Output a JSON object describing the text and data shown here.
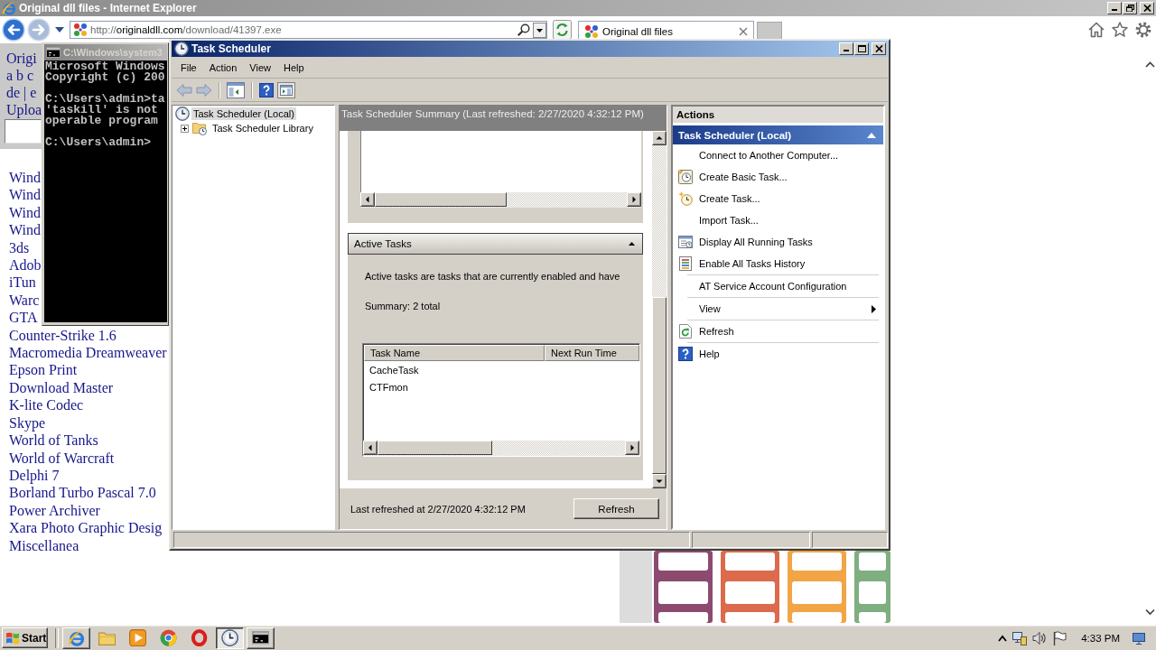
{
  "browser": {
    "title": "Original dll files - Internet Explorer",
    "address": {
      "scheme": "http://",
      "domain": "originaldll.com",
      "path": "/download/41397.exe"
    },
    "tabs": [
      {
        "label": "Original dll files",
        "selected": true
      }
    ]
  },
  "web_page": {
    "header_lines": [
      "Origi",
      "a b c",
      "de | e",
      "Uploa"
    ],
    "links": [
      "Wind",
      "Wind",
      "Wind",
      "Wind",
      "3ds",
      "Adob",
      "iTun",
      "Warc",
      "GTA",
      "Counter-Strike 1.6",
      "Macromedia Dreamweaver",
      "Epson Print",
      "Download Master",
      "K-lite Codec",
      "Skype",
      "World of Tanks",
      "World of Warcraft",
      "Delphi 7",
      "Borland Turbo Pascal 7.0",
      "Power Archiver",
      "Xara Photo Graphic Desig",
      "Miscellanea"
    ]
  },
  "console": {
    "title": "C:\\Windows\\system3",
    "paragraphs": [
      [
        "Microsoft Windows",
        "Copyright (c) 200"
      ],
      [
        "C:\\Users\\admin>ta",
        "'taskill' is not",
        "operable program"
      ],
      [
        "C:\\Users\\admin>"
      ]
    ]
  },
  "task_scheduler": {
    "title": "Task Scheduler",
    "menu": [
      "File",
      "Action",
      "View",
      "Help"
    ],
    "tree": [
      {
        "label": "Task Scheduler (Local)",
        "selected": true,
        "children": [
          {
            "label": "Task Scheduler Library",
            "selected": false,
            "expanded": false
          }
        ]
      }
    ],
    "summary_title": "Task Scheduler Summary (Last refreshed: 2/27/2020 4:32:12 PM)",
    "active_tasks": {
      "title": "Active Tasks",
      "expanded": true,
      "description": "Active tasks are tasks that are currently enabled and have",
      "summary": "Summary: 2 total",
      "columns": [
        "Task Name",
        "Next Run Time"
      ],
      "rows": [
        {
          "task_name": "CacheTask"
        },
        {
          "task_name": "CTFmon"
        }
      ]
    },
    "footer": {
      "status": "Last refreshed at 2/27/2020 4:32:12 PM",
      "button": "Refresh"
    },
    "actions": {
      "title": "Actions",
      "section": {
        "title": "Task Scheduler (Local)",
        "expanded": true
      },
      "groups": [
        [
          {
            "label": "Connect to Another Computer...",
            "kind": "plain"
          },
          {
            "label": "Create Basic Task...",
            "kind": "wizard"
          },
          {
            "label": "Create Task...",
            "kind": "task"
          },
          {
            "label": "Import Task...",
            "kind": "plain"
          },
          {
            "label": "Display All Running Tasks",
            "kind": "running"
          },
          {
            "label": "Enable All Tasks History",
            "kind": "history"
          }
        ],
        [
          {
            "label": "AT Service Account Configuration",
            "kind": "plain"
          }
        ],
        [
          {
            "label": "View",
            "kind": "submenu"
          }
        ],
        [
          {
            "label": "Refresh",
            "kind": "refresh"
          }
        ],
        [
          {
            "label": "Help",
            "kind": "help"
          }
        ]
      ]
    }
  },
  "taskbar": {
    "start": "Start",
    "apps": [
      {
        "kind": "browser",
        "running": true,
        "selected": false
      },
      {
        "kind": "files",
        "running": false,
        "selected": false
      },
      {
        "kind": "media",
        "running": false,
        "selected": false
      },
      {
        "kind": "globe",
        "running": false,
        "selected": false
      },
      {
        "kind": "ring",
        "running": false,
        "selected": false
      },
      {
        "kind": "scheduler",
        "running": true,
        "selected": true
      },
      {
        "kind": "console",
        "running": true,
        "selected": false
      }
    ],
    "clock": "4:33 PM"
  }
}
